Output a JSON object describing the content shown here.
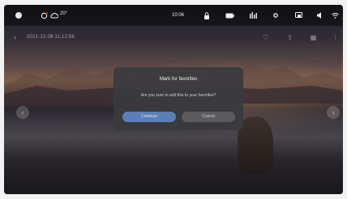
{
  "statusbar": {
    "weather": "20°",
    "time": "10:06"
  },
  "titlebar": {
    "photo_date": "2021-12-08 11:12:56"
  },
  "dialog": {
    "title": "Mark for favorites",
    "message": "Are you sure to add this to your favorites?",
    "confirm_label": "Continue",
    "cancel_label": "Cancel"
  },
  "colors": {
    "confirm_button": "#5a7fb8",
    "cancel_button": "#5b5b5f"
  }
}
